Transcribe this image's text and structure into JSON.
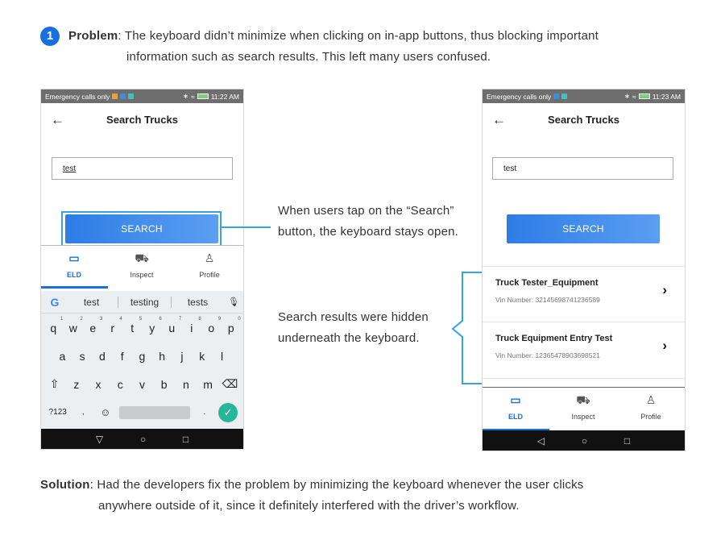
{
  "problem": {
    "number": "1",
    "label": "Problem",
    "text_line1": ": The keyboard didn’t minimize when clicking on in-app buttons, thus blocking important",
    "text_line2": "information such as search results. This left many users confused."
  },
  "left_phone": {
    "status": {
      "left": "Emergency calls only",
      "time": "11:22 AM"
    },
    "title": "Search Trucks",
    "search_value": "test",
    "search_button": "SEARCH",
    "nav": [
      {
        "label": "ELD",
        "icon": "eld-icon",
        "active": true
      },
      {
        "label": "Inspect",
        "icon": "truck-inspect-icon",
        "active": false
      },
      {
        "label": "Profile",
        "icon": "person-icon",
        "active": false
      }
    ],
    "keyboard": {
      "suggestions": [
        "test",
        "testing",
        "tests"
      ],
      "row1": [
        "q",
        "w",
        "e",
        "r",
        "t",
        "y",
        "u",
        "i",
        "o",
        "p"
      ],
      "row1_numbers": [
        "1",
        "2",
        "3",
        "4",
        "5",
        "6",
        "7",
        "8",
        "9",
        "0"
      ],
      "row2": [
        "a",
        "s",
        "d",
        "f",
        "g",
        "h",
        "j",
        "k",
        "l"
      ],
      "row3": [
        "z",
        "x",
        "c",
        "v",
        "b",
        "n",
        "m"
      ],
      "symbols_key": "?123",
      "comma_key": ",",
      "period_key": "."
    }
  },
  "right_phone": {
    "status": {
      "left": "Emergency calls only",
      "time": "11:23 AM"
    },
    "title": "Search Trucks",
    "search_value": "test",
    "search_button": "SEARCH",
    "results": [
      {
        "title": "Truck Tester_Equipment",
        "vin": "Vin Number: 32145698741236589"
      },
      {
        "title": "Truck Equipment Entry Test",
        "vin": "Vin Number: 12365478903698521"
      }
    ],
    "nav": [
      {
        "label": "ELD",
        "icon": "eld-icon",
        "active": true
      },
      {
        "label": "Inspect",
        "icon": "truck-inspect-icon",
        "active": false
      },
      {
        "label": "Profile",
        "icon": "person-icon",
        "active": false
      }
    ]
  },
  "notes": {
    "note1": "When users tap on the “Search” button, the keyboard stays open.",
    "note2": "Search results were hidden underneath the keyboard."
  },
  "solution": {
    "label": "Solution",
    "text_line1": ": Had the developers fix the problem by minimizing the keyboard whenever the user clicks",
    "text_line2": "anywhere outside of it, since it definitely interfered with the driver’s workflow."
  },
  "colors": {
    "accent": "#1a6fe0",
    "highlight": "#36a3e3",
    "button_start": "#2d7de6",
    "button_end": "#5b9ef1",
    "enter_key": "#26b79b"
  }
}
